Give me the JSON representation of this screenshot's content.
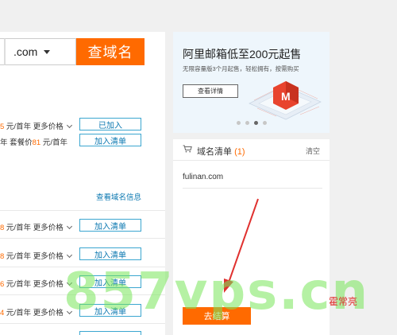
{
  "search": {
    "tld": ".com",
    "button": "查域名"
  },
  "results_top": [
    {
      "price_prefix": "",
      "price": "5",
      "price_suffix": " 元/首年 更多价格",
      "button": "已加入"
    },
    {
      "price_prefix": "年 套餐价",
      "price": "81",
      "price_suffix": " 元/首年",
      "button": "加入清单"
    }
  ],
  "info_link": "查看域名信息",
  "results_more": [
    {
      "price": "8",
      "price_suffix": " 元/首年 更多价格",
      "button": "加入清单"
    },
    {
      "price": "8",
      "price_suffix": " 元/首年 更多价格",
      "button": "加入清单"
    },
    {
      "price": "6",
      "price_suffix": " 元/首年 更多价格",
      "button": "加入清单"
    },
    {
      "price": "4",
      "price_suffix": " 元/首年 更多价格",
      "button": "加入清单"
    },
    {
      "price": "",
      "price_suffix": "",
      "button": ""
    }
  ],
  "banner": {
    "title": "阿里邮箱低至200元起售",
    "subtitle": "无限容量版3个月起售，轻松拥有，按需购买",
    "button": "查看详情",
    "dots_total": 4,
    "dots_active": 3
  },
  "cart": {
    "title": "域名清单",
    "count": "(1)",
    "clear": "清空",
    "items": [
      "fulinan.com"
    ],
    "checkout": "去结算"
  },
  "watermark": {
    "text": "857vps.cn",
    "note": "霍常亮"
  },
  "colors": {
    "accent": "#ff6a00",
    "link": "#0a77b0",
    "border": "#3ba6d0"
  }
}
